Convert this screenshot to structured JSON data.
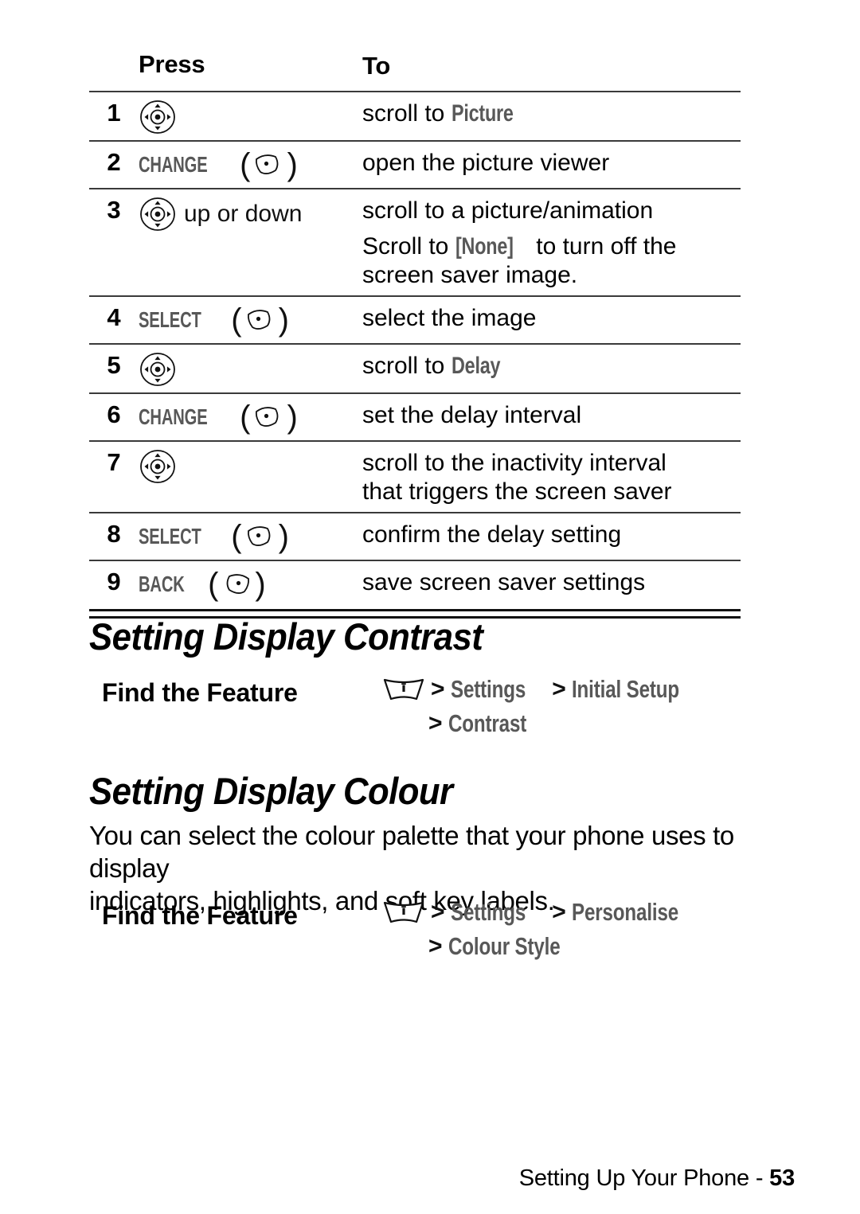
{
  "table": {
    "headers": {
      "num": "",
      "press": "Press",
      "to": "To"
    },
    "rows": [
      {
        "num": "1",
        "press_icon": "nav-key-icon",
        "press_label": "",
        "press_suffix": "",
        "to_lines": [
          {
            "text": "scroll to ",
            "term": "Picture",
            "tail": ""
          }
        ]
      },
      {
        "num": "2",
        "press_icon": "right-soft-key-icon",
        "press_label": "CHANGE",
        "press_suffix": "",
        "to_lines": [
          {
            "text": "open the picture viewer",
            "term": "",
            "tail": ""
          }
        ]
      },
      {
        "num": "3",
        "press_icon": "nav-key-icon",
        "press_label": "",
        "press_suffix": "up or down",
        "to_lines": [
          {
            "text": "scroll to a picture/animation",
            "term": "",
            "tail": ""
          },
          {
            "text": "Scroll to ",
            "term": "[None]",
            "tail": " to turn off the"
          },
          {
            "text": "screen saver image.",
            "term": "",
            "tail": ""
          }
        ]
      },
      {
        "num": "4",
        "press_icon": "right-soft-key-icon",
        "press_label": "SELECT",
        "press_suffix": "",
        "to_lines": [
          {
            "text": "select the image",
            "term": "",
            "tail": ""
          }
        ]
      },
      {
        "num": "5",
        "press_icon": "nav-key-icon",
        "press_label": "",
        "press_suffix": "",
        "to_lines": [
          {
            "text": "scroll to ",
            "term": "Delay",
            "tail": ""
          }
        ]
      },
      {
        "num": "6",
        "press_icon": "right-soft-key-icon",
        "press_label": "CHANGE",
        "press_suffix": "",
        "to_lines": [
          {
            "text": "set the delay interval",
            "term": "",
            "tail": ""
          }
        ]
      },
      {
        "num": "7",
        "press_icon": "nav-key-icon",
        "press_label": "",
        "press_suffix": "",
        "to_lines": [
          {
            "text": "scroll to the inactivity interval",
            "term": "",
            "tail": ""
          },
          {
            "text": "that triggers the screen saver",
            "term": "",
            "tail": ""
          }
        ]
      },
      {
        "num": "8",
        "press_icon": "right-soft-key-icon",
        "press_label": "SELECT",
        "press_suffix": "",
        "to_lines": [
          {
            "text": "confirm the delay setting",
            "term": "",
            "tail": ""
          }
        ]
      },
      {
        "num": "9",
        "press_icon": "left-soft-key-icon",
        "press_label": "BACK",
        "press_suffix": "",
        "to_lines": [
          {
            "text": "save screen saver settings",
            "term": "",
            "tail": ""
          }
        ]
      }
    ]
  },
  "section_contrast": {
    "heading": "Setting Display Contrast",
    "find_label": "Find the Feature",
    "menu_icon": "menu-key-icon",
    "path_line1": [
      {
        "chev": ">",
        "term": "Settings"
      },
      {
        "chev": ">",
        "term": "Initial Setup"
      }
    ],
    "path_line2": [
      {
        "chev": ">",
        "term": "Contrast"
      }
    ]
  },
  "section_colour": {
    "heading": "Setting Display Colour",
    "paragraph_lines": [
      "You can select the colour palette that your phone uses to display",
      "indicators, highlights, and soft key labels."
    ],
    "find_label": "Find the Feature",
    "menu_icon": "menu-key-icon",
    "path_line1": [
      {
        "chev": ">",
        "term": "Settings"
      },
      {
        "chev": ">",
        "term": "Personalise"
      }
    ],
    "path_line2": [
      {
        "chev": ">",
        "term": "Colour Style"
      }
    ]
  },
  "footer": {
    "text": "Setting Up Your Phone - ",
    "page_number": "53"
  },
  "colors": {
    "ui_term_gray": "#585858",
    "text_black": "#000000",
    "rule_gray": "#3a3a3a"
  }
}
